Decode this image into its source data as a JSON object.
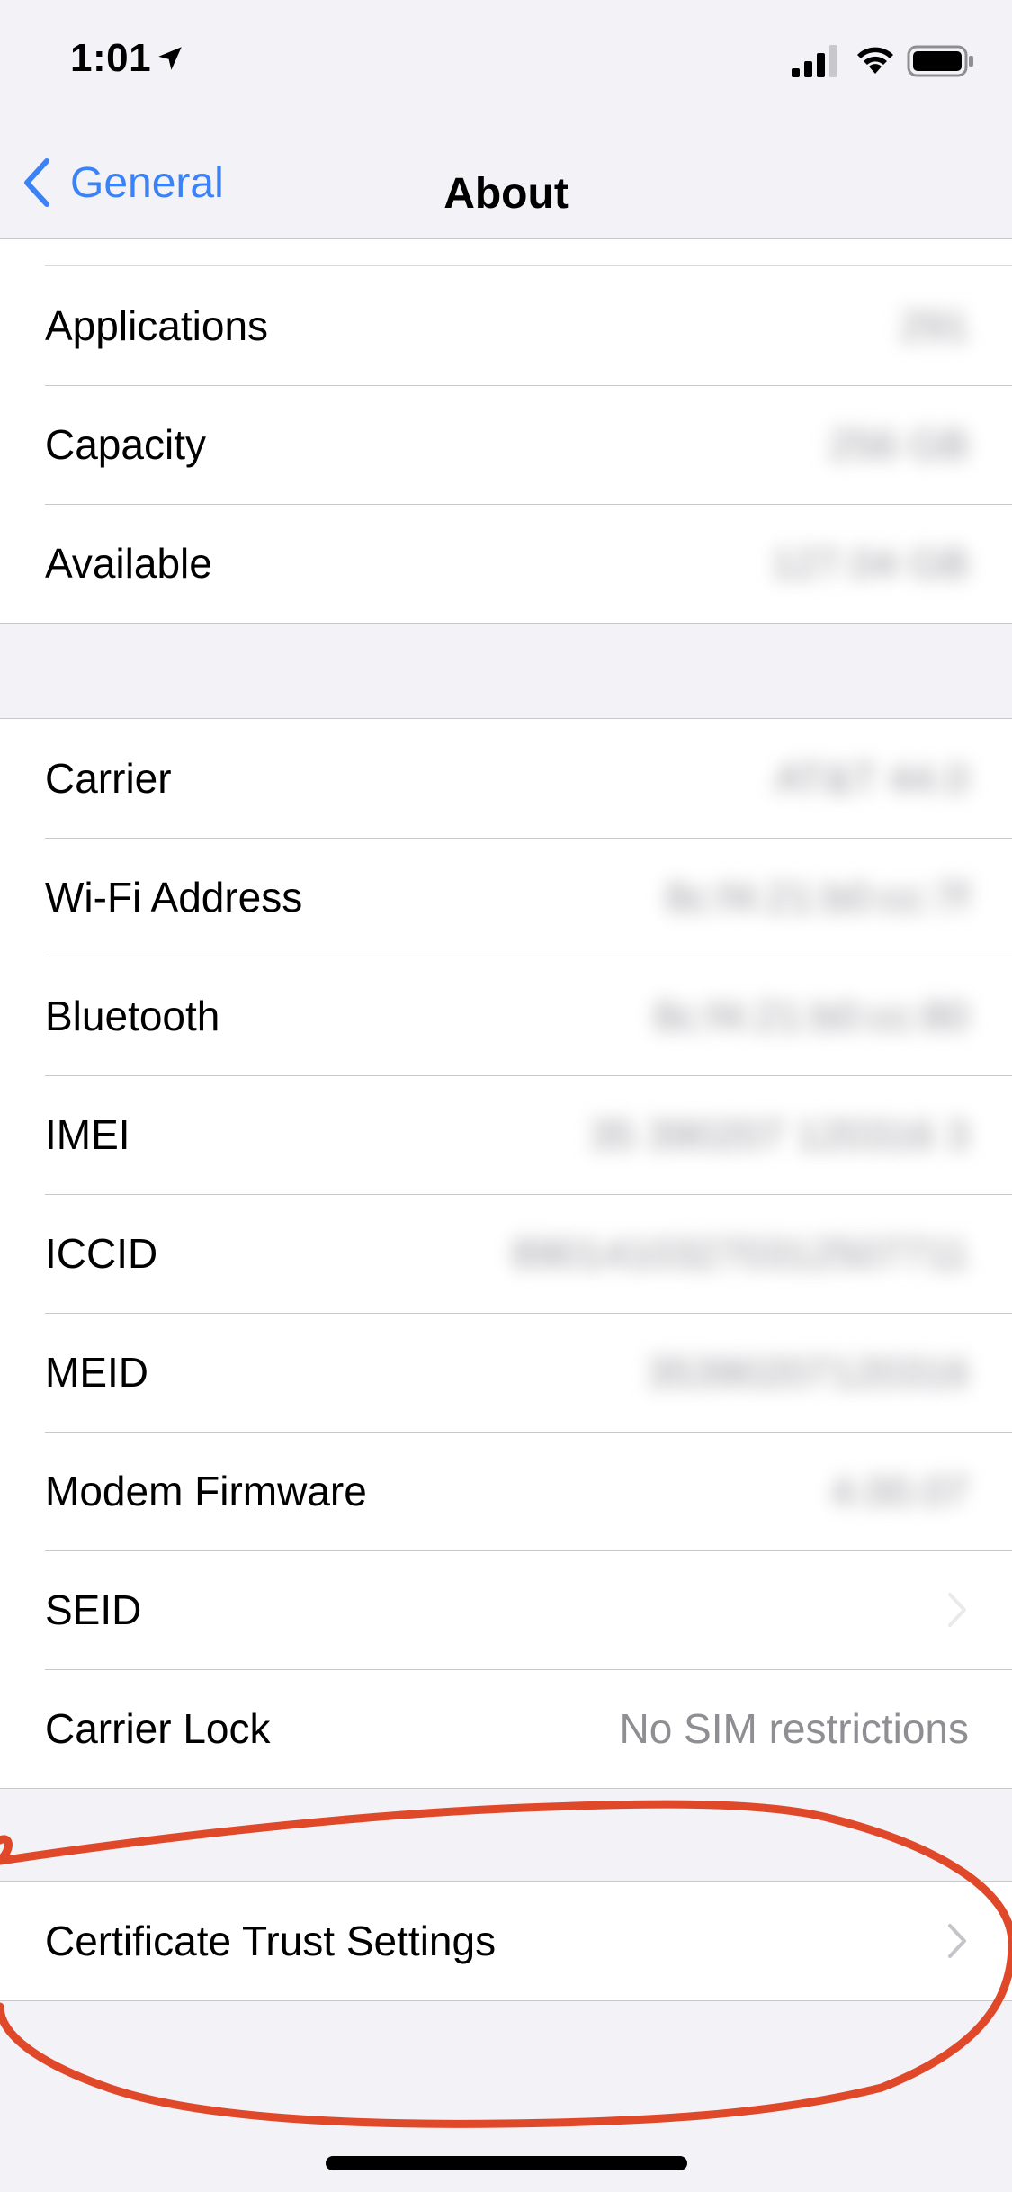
{
  "status_bar": {
    "time": "1:01",
    "icons": [
      "location-arrow-icon",
      "cellular-signal-icon",
      "wifi-icon",
      "battery-icon"
    ]
  },
  "nav": {
    "back_label": "General",
    "title": "About"
  },
  "colors": {
    "accent": "#3a82f6",
    "annotation": "#e0482a",
    "secondary_text": "#8e8e93",
    "background": "#f2f2f7"
  },
  "group1": {
    "rows": [
      {
        "label": "Applications",
        "value": "291"
      },
      {
        "label": "Capacity",
        "value": "256 GB"
      },
      {
        "label": "Available",
        "value": "127.04 GB"
      }
    ]
  },
  "group2": {
    "rows": [
      {
        "label": "Carrier",
        "value": "AT&T 44.0"
      },
      {
        "label": "Wi-Fi Address",
        "value": "8c:f4:21:b0:cc:7f"
      },
      {
        "label": "Bluetooth",
        "value": "8c:f4:21:b0:cc:80"
      },
      {
        "label": "IMEI",
        "value": "35 390207 120316 3"
      },
      {
        "label": "ICCID",
        "value": "89014103270312507711"
      },
      {
        "label": "MEID",
        "value": "35390207120316"
      },
      {
        "label": "Modem Firmware",
        "value": "4.00.07"
      },
      {
        "label": "SEID"
      },
      {
        "label": "Carrier Lock",
        "value": "No SIM restrictions"
      }
    ]
  },
  "group3": {
    "rows": [
      {
        "label": "Certificate Trust Settings"
      }
    ]
  }
}
